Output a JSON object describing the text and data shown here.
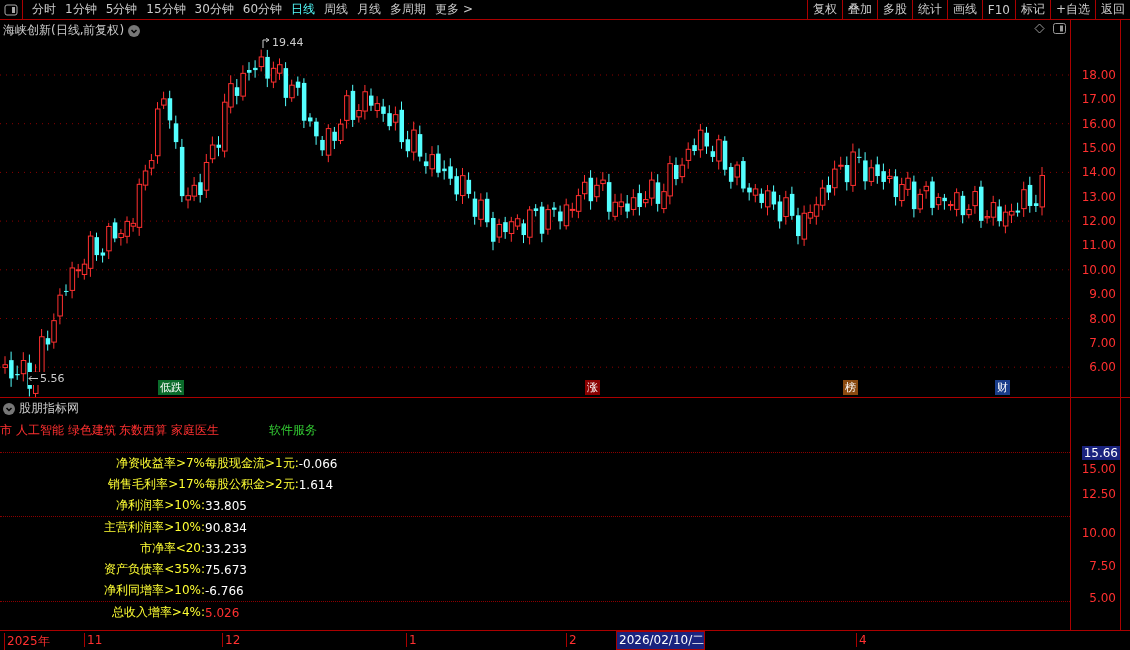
{
  "toolbar": {
    "periods": [
      {
        "label": "分时",
        "selected": false
      },
      {
        "label": "1分钟",
        "selected": false
      },
      {
        "label": "5分钟",
        "selected": false
      },
      {
        "label": "15分钟",
        "selected": false
      },
      {
        "label": "30分钟",
        "selected": false
      },
      {
        "label": "60分钟",
        "selected": false
      },
      {
        "label": "日线",
        "selected": true
      },
      {
        "label": "周线",
        "selected": false
      },
      {
        "label": "月线",
        "selected": false
      },
      {
        "label": "多周期",
        "selected": false
      },
      {
        "label": "更多 >",
        "selected": false
      }
    ],
    "buttons": [
      "复权",
      "叠加",
      "多股",
      "统计",
      "画线",
      "F10",
      "标记",
      "+自选",
      "返回"
    ]
  },
  "chart": {
    "title": "海峡创新(日线,前复权)",
    "high_label": "19.44",
    "low_label": "5.56",
    "y_axis": [
      "18.00",
      "17.00",
      "16.00",
      "15.00",
      "14.00",
      "13.00",
      "12.00",
      "11.00",
      "10.00",
      "9.00",
      "8.00",
      "7.00",
      "6.00"
    ],
    "signals": [
      {
        "text": "低跌",
        "kind": "fall"
      },
      {
        "text": "涨",
        "kind": "rise"
      },
      {
        "text": "榜",
        "kind": "list"
      },
      {
        "text": "财",
        "kind": "finance"
      }
    ]
  },
  "indicator": {
    "title": "股朋指标网",
    "concepts": "市 人工智能 绿色建筑 东数西算 家庭医生",
    "industry": "软件服务",
    "rows": [
      {
        "label": "净资收益率>7%",
        "extra_label": "每股现金流>1元:",
        "value": "-0.066",
        "highlighted": false
      },
      {
        "label": "销售毛利率>17%",
        "extra_label": "每股公积金>2元:",
        "value": "1.614",
        "highlighted": false
      },
      {
        "label": "净利润率>10%:",
        "value": "33.805",
        "highlighted": false
      },
      {
        "label": "主营利润率>10%:",
        "value": "90.834",
        "highlighted": false
      },
      {
        "label": "市净率<20:",
        "value": "33.233",
        "highlighted": false
      },
      {
        "label": "资产负债率<35%:",
        "value": "75.673",
        "highlighted": false
      },
      {
        "label": "净利同增率>10%:",
        "value": "-6.766",
        "highlighted": false
      },
      {
        "label": "总收入增率>4%:",
        "value": "5.026",
        "highlighted": true
      }
    ],
    "y_axis": [
      {
        "text": "15.66",
        "selected": true
      },
      {
        "text": "15.00",
        "selected": false
      },
      {
        "text": "12.50",
        "selected": false
      },
      {
        "text": "10.00",
        "selected": false
      },
      {
        "text": "7.50",
        "selected": false
      },
      {
        "text": "5.00",
        "selected": false
      }
    ]
  },
  "time_axis": [
    {
      "label": "2025年",
      "selected": false
    },
    {
      "label": "11",
      "selected": false
    },
    {
      "label": "12",
      "selected": false
    },
    {
      "label": "1",
      "selected": false
    },
    {
      "label": "2",
      "selected": false
    },
    {
      "label": "2026/02/10/二",
      "selected": true
    },
    {
      "label": "4",
      "selected": false
    }
  ]
}
